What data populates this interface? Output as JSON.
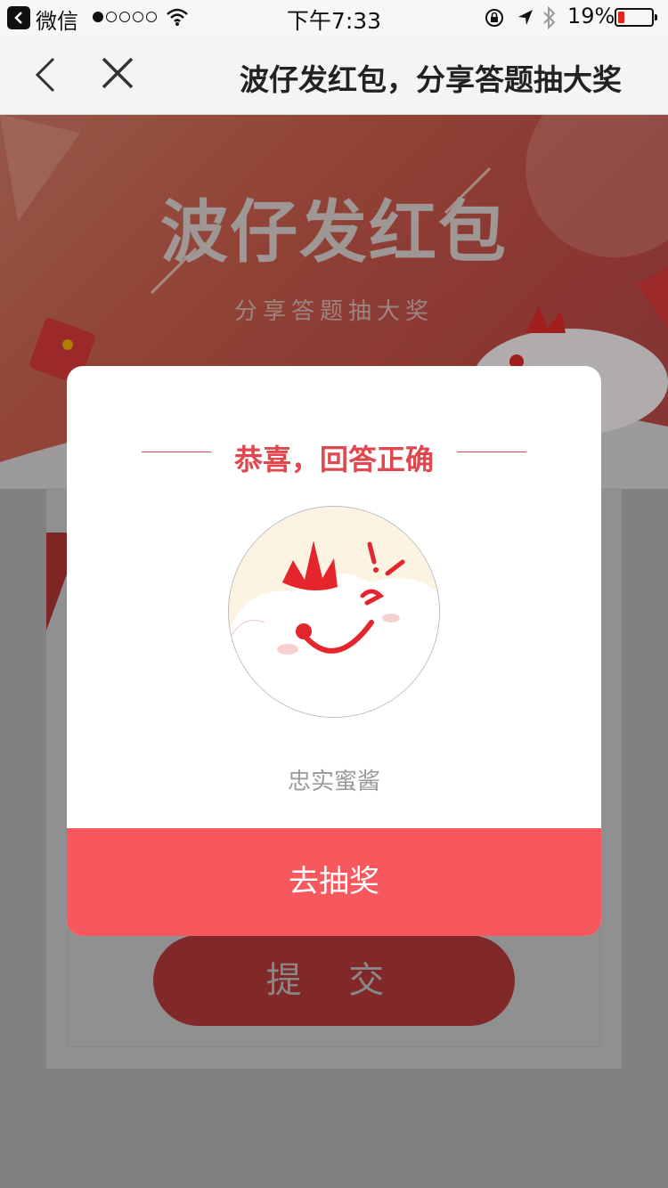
{
  "status_bar": {
    "back_app": "微信",
    "time": "下午7:33",
    "battery_percent": "19%",
    "battery_level": 0.19,
    "signal_bars_filled": 1,
    "signal_bars_total": 5,
    "icons": [
      "signal-dots-icon",
      "wifi-icon",
      "orientation-lock-icon",
      "location-arrow-icon",
      "bluetooth-icon",
      "battery-icon"
    ]
  },
  "nav": {
    "title": "波仔发红包，分享答题抽大奖",
    "icons": [
      "back-chevron-icon",
      "close-icon"
    ]
  },
  "banner": {
    "headline": "波仔发红包",
    "subtitle": "分享答题抽大奖"
  },
  "page": {
    "submit_label": "提 交"
  },
  "modal": {
    "heading": "恭喜，回答正确",
    "nickname": "忠实蜜酱",
    "lottery_label": "去抽奖",
    "accent_color": "#f7585e",
    "heading_color": "#e0474e"
  }
}
